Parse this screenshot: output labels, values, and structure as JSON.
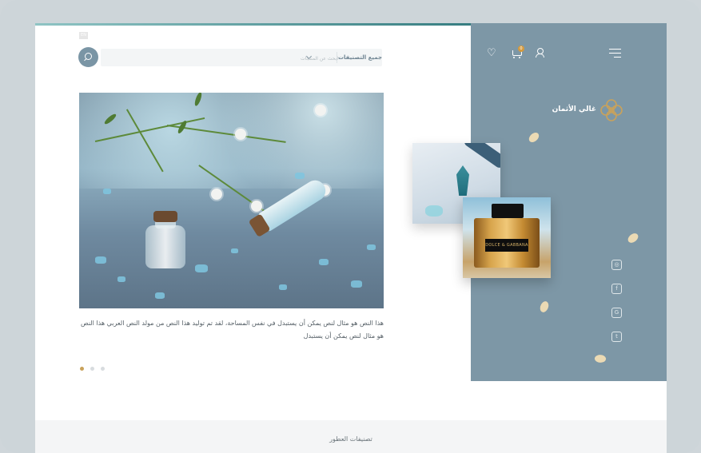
{
  "header": {
    "language_badge": "EN",
    "search": {
      "placeholder": "ابحث عن المنتجات",
      "category_select": "جميع التصنيفات"
    }
  },
  "sidebar": {
    "brand_name": "غالي الأثمان",
    "cart_count": "0",
    "social": [
      "instagram-icon",
      "facebook-icon",
      "google-plus-icon",
      "twitter-icon"
    ]
  },
  "hero": {
    "description": "هذا النص هو مثال لنص يمكن أن يستبدل في نفس المساحة، لقد تم توليد هذا النص من مولد النص العربي هذا النص هو مثال لنص يمكن أن يستبدل",
    "slides": 3,
    "active_slide": 0
  },
  "product_card": {
    "perfume_label": "DOLCE & GABBANA"
  },
  "footer": {
    "section_title": "تصنيفات العطور"
  },
  "colors": {
    "sidebar_bg": "#7d97a6",
    "accent_gold": "#c9a25b",
    "search_button": "#7a95a5"
  }
}
